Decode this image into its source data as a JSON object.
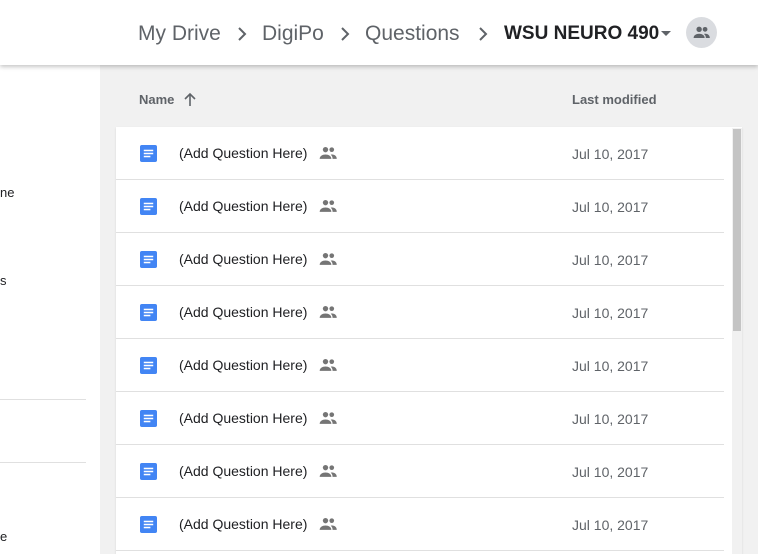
{
  "breadcrumb": {
    "items": [
      "My Drive",
      "DigiPo",
      "Questions"
    ],
    "current": "WSU NEURO 490"
  },
  "sidebar": {
    "fragments": [
      "ne",
      "s",
      "e"
    ]
  },
  "columns": {
    "name": "Name",
    "last_modified": "Last modified",
    "sort_direction": "ascending"
  },
  "files": [
    {
      "name": "(Add Question Here)",
      "modified": "Jul 10, 2017",
      "type": "google-doc",
      "shared": true
    },
    {
      "name": "(Add Question Here)",
      "modified": "Jul 10, 2017",
      "type": "google-doc",
      "shared": true
    },
    {
      "name": "(Add Question Here)",
      "modified": "Jul 10, 2017",
      "type": "google-doc",
      "shared": true
    },
    {
      "name": "(Add Question Here)",
      "modified": "Jul 10, 2017",
      "type": "google-doc",
      "shared": true
    },
    {
      "name": "(Add Question Here)",
      "modified": "Jul 10, 2017",
      "type": "google-doc",
      "shared": true
    },
    {
      "name": "(Add Question Here)",
      "modified": "Jul 10, 2017",
      "type": "google-doc",
      "shared": true
    },
    {
      "name": "(Add Question Here)",
      "modified": "Jul 10, 2017",
      "type": "google-doc",
      "shared": true
    },
    {
      "name": "(Add Question Here)",
      "modified": "Jul 10, 2017",
      "type": "google-doc",
      "shared": true
    }
  ],
  "colors": {
    "doc_blue": "#4285f4",
    "text_secondary": "#5f6368",
    "divider": "#e0e0e0"
  }
}
